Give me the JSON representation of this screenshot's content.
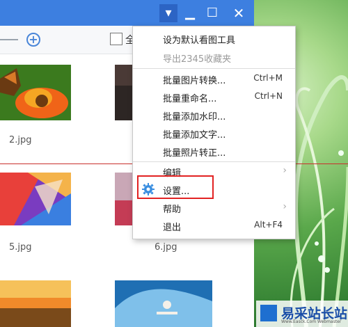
{
  "window": {
    "dropdown_icon": "chevron-down-icon",
    "minimize_icon": "minimize-icon",
    "maximize_icon": "maximize-icon",
    "close_icon": "close-icon"
  },
  "toolbar": {
    "select_all_label": "全"
  },
  "thumbnails": [
    {
      "name": "2.jpg"
    },
    {
      "name": "5.jpg"
    },
    {
      "name": "6.jpg"
    }
  ],
  "menu": {
    "items": [
      {
        "label": "设为默认看图工具",
        "shortcut": "",
        "disabled": false
      },
      {
        "label": "导出2345收藏夹",
        "shortcut": "",
        "disabled": true
      },
      {
        "label": "批量图片转换...",
        "shortcut": "Ctrl+M"
      },
      {
        "label": "批量重命名...",
        "shortcut": "Ctrl+N"
      },
      {
        "label": "批量添加水印...",
        "shortcut": ""
      },
      {
        "label": "批量添加文字...",
        "shortcut": ""
      },
      {
        "label": "批量照片转正...",
        "shortcut": ""
      },
      {
        "label": "编辑",
        "submenu": true
      },
      {
        "label": "设置...",
        "icon": "gear-icon"
      },
      {
        "label": "帮助",
        "submenu": true
      },
      {
        "label": "退出",
        "shortcut": "Alt+F4"
      }
    ]
  },
  "watermark": {
    "text": "易采站长站",
    "sub": "Www.Easck.Com Webmaster"
  },
  "colors": {
    "titlebar": "#3d7fe0",
    "highlight": "#e22222"
  }
}
